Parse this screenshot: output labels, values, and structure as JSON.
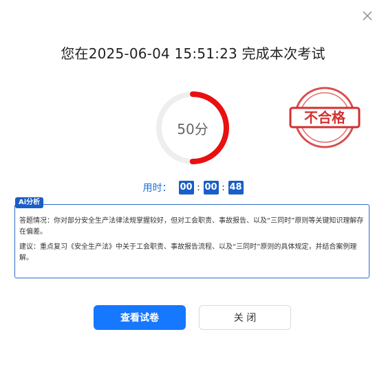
{
  "dialog": {
    "title": "您在2025-06-04 15:51:23 完成本次考试",
    "score": {
      "text": "50分",
      "progress_fraction": 0.5,
      "ring_color": "#e81010",
      "track_color": "#eeeeee"
    },
    "stamp": {
      "text": "不合格",
      "color": "#d32f2f"
    },
    "timer": {
      "label": "用时：",
      "hours": "00",
      "minutes": "00",
      "seconds": "48",
      "separator": ":"
    },
    "analysis": {
      "tag": "Ai分析",
      "summary": "答题情况：你对部分安全生产法律法规掌握较好，但对工会职责、事故报告、以及“三同时”原则等关键知识理解存在偏差。",
      "suggestion": "建议：重点复习《安全生产法》中关于工会职责、事故报告流程、以及“三同时”原则的具体规定，并结合案例理解。"
    },
    "buttons": {
      "view_paper": "查看试卷",
      "close": "关 闭"
    },
    "accent_color": "#1677ff"
  }
}
